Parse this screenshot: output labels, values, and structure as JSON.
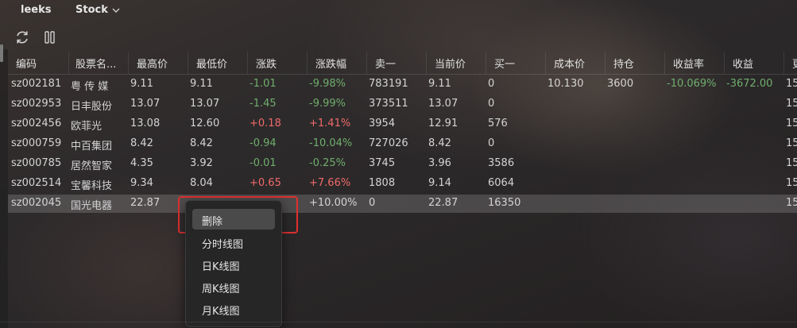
{
  "top_bar": {
    "tab_leeks": "leeks",
    "tab_stock": "Stock"
  },
  "toolbar": {
    "refresh_icon": "refresh-icon",
    "pause_icon": "pause-icon"
  },
  "columns": [
    "编码",
    "股票名...",
    "最高价",
    "最低价",
    "涨跌",
    "涨跌幅",
    "卖一",
    "当前价",
    "买一",
    "成本价",
    "持仓",
    "收益率",
    "收益",
    "更"
  ],
  "rows": [
    {
      "code": "sz002181",
      "name": "粤 传 媒",
      "high": "9.11",
      "low": "9.11",
      "change": "-1.01",
      "change_pct": "-9.98%",
      "sell1": "783191",
      "price": "9.11",
      "buy1": "0",
      "cost": "10.130",
      "holding": "3600",
      "return_rate": "-10.069%",
      "profit": "-3672.00",
      "update": "15",
      "trend": "down",
      "has_position": true
    },
    {
      "code": "sz002953",
      "name": "日丰股份",
      "high": "13.07",
      "low": "13.07",
      "change": "-1.45",
      "change_pct": "-9.99%",
      "sell1": "373511",
      "price": "13.07",
      "buy1": "0",
      "cost": "",
      "holding": "",
      "return_rate": "",
      "profit": "",
      "update": "15",
      "trend": "down",
      "has_position": false
    },
    {
      "code": "sz002456",
      "name": "欧菲光",
      "high": "13.08",
      "low": "12.60",
      "change": "+0.18",
      "change_pct": "+1.41%",
      "sell1": "3954",
      "price": "12.91",
      "buy1": "576",
      "cost": "",
      "holding": "",
      "return_rate": "",
      "profit": "",
      "update": "15",
      "trend": "up",
      "has_position": false
    },
    {
      "code": "sz000759",
      "name": "中百集团",
      "high": "8.42",
      "low": "8.42",
      "change": "-0.94",
      "change_pct": "-10.04%",
      "sell1": "727026",
      "price": "8.42",
      "buy1": "0",
      "cost": "",
      "holding": "",
      "return_rate": "",
      "profit": "",
      "update": "15",
      "trend": "down",
      "has_position": false
    },
    {
      "code": "sz000785",
      "name": "居然智家",
      "high": "4.35",
      "low": "3.92",
      "change": "-0.01",
      "change_pct": "-0.25%",
      "sell1": "3745",
      "price": "3.96",
      "buy1": "3586",
      "cost": "",
      "holding": "",
      "return_rate": "",
      "profit": "",
      "update": "15",
      "trend": "down",
      "has_position": false
    },
    {
      "code": "sz002514",
      "name": "宝馨科技",
      "high": "9.34",
      "low": "8.04",
      "change": "+0.65",
      "change_pct": "+7.66%",
      "sell1": "1808",
      "price": "9.14",
      "buy1": "6064",
      "cost": "",
      "holding": "",
      "return_rate": "",
      "profit": "",
      "update": "15",
      "trend": "up",
      "has_position": false
    },
    {
      "code": "sz002045",
      "name": "国光电器",
      "high": "22.87",
      "low": "",
      "change": "",
      "change_pct": "+10.00%",
      "sell1": "0",
      "price": "22.87",
      "buy1": "16350",
      "cost": "",
      "holding": "",
      "return_rate": "",
      "profit": "",
      "update": "15",
      "trend": "neutral",
      "has_position": false,
      "selected": true
    }
  ],
  "context_menu": {
    "items": [
      "删除",
      "分时线图",
      "日K线图",
      "周K线图",
      "月K线图"
    ],
    "active_index": 0
  },
  "colors": {
    "up": "#f06a6a",
    "down": "#6fae6c",
    "highlight_border": "#e03030"
  }
}
